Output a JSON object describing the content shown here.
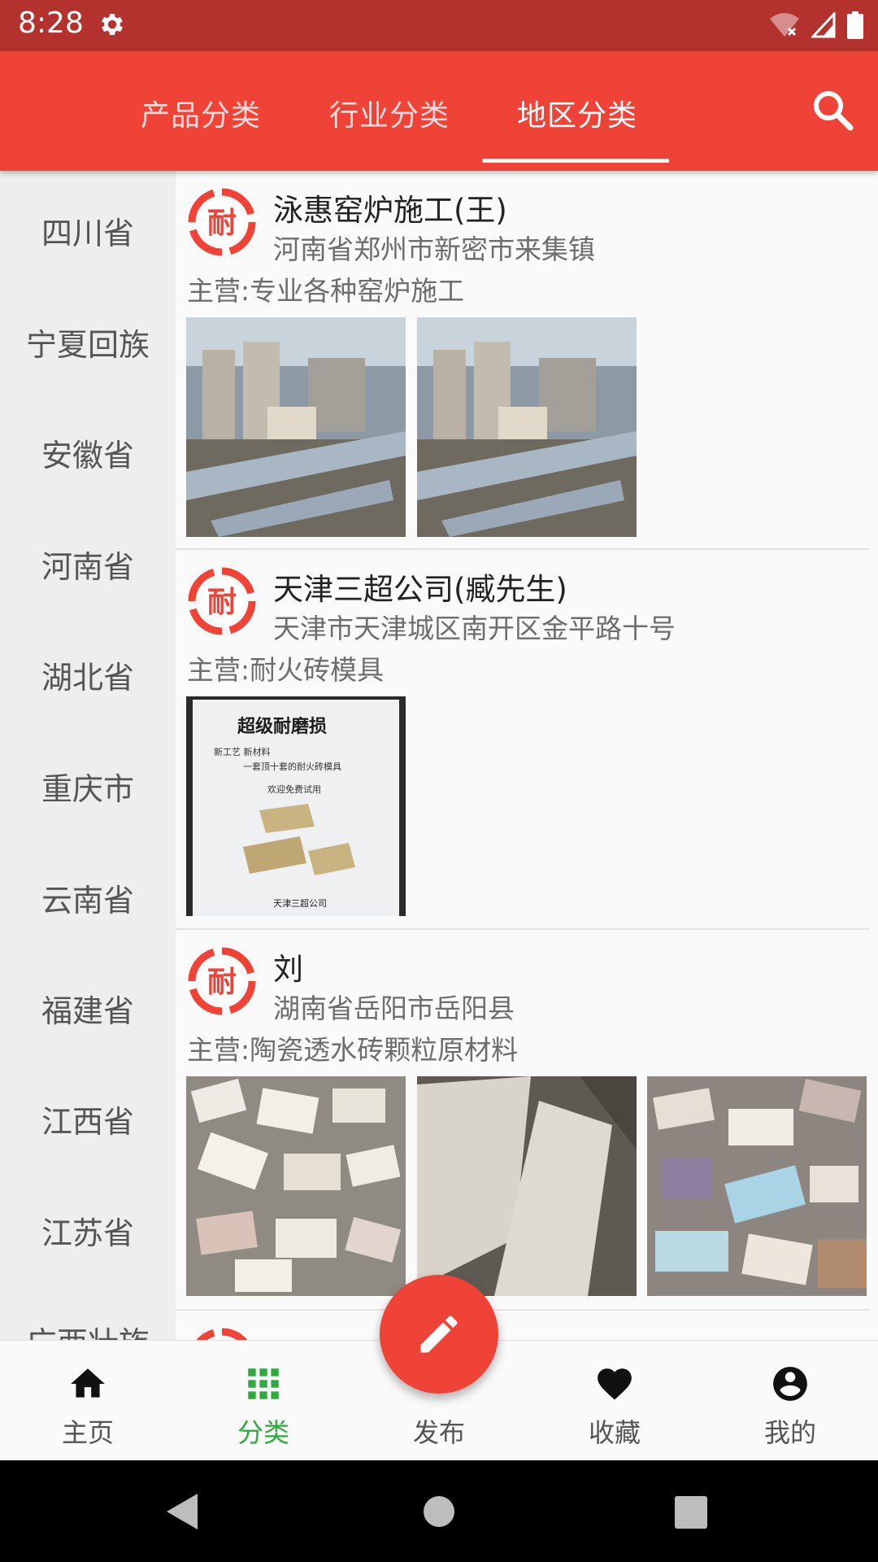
{
  "status_bar": {
    "time": "8:28",
    "icons": [
      "gear-icon",
      "wifi-off-icon",
      "signal-icon",
      "battery-icon"
    ]
  },
  "tabs": [
    {
      "label": "产品分类",
      "active": false
    },
    {
      "label": "行业分类",
      "active": false
    },
    {
      "label": "地区分类",
      "active": true
    }
  ],
  "sidebar": {
    "items": [
      "四川省",
      "宁夏回族",
      "安徽省",
      "河南省",
      "湖北省",
      "重庆市",
      "云南省",
      "福建省",
      "江西省",
      "江苏省",
      "广西壮族"
    ]
  },
  "listings": [
    {
      "logo_char": "耐",
      "name": "泳惠窑炉施工(王)",
      "address": "河南省郑州市新密市来集镇",
      "main": "主营:专业各种窑炉施工",
      "photos": [
        "kiln-construction-photo",
        "kiln-construction-photo"
      ]
    },
    {
      "logo_char": "耐",
      "name": "天津三超公司(臧先生)",
      "address": "天津市天津城区南开区金平路十号",
      "main": "主营:耐火砖模具",
      "photos": [
        "brick-mold-poster-photo"
      ],
      "poster": {
        "title": "超级耐磨损",
        "line1": "新工艺 新材料",
        "line2": "一套顶十套的耐火砖模具",
        "line3": "欢迎免费试用",
        "company": "天津三超公司"
      }
    },
    {
      "logo_char": "耐",
      "name": "刘",
      "address": "湖南省岳阳市岳阳县",
      "main": "主营:陶瓷透水砖颗粒原材料",
      "photos": [
        "ceramic-bricks-photo",
        "stone-slab-photo",
        "ceramic-bricks-photo"
      ]
    }
  ],
  "bottom_nav": [
    {
      "label": "主页",
      "icon": "home-icon",
      "active": false
    },
    {
      "label": "分类",
      "icon": "grid-icon",
      "active": true
    },
    {
      "label": "发布",
      "icon": "pencil-icon",
      "active": false
    },
    {
      "label": "收藏",
      "icon": "heart-icon",
      "active": false
    },
    {
      "label": "我的",
      "icon": "account-icon",
      "active": false
    }
  ],
  "colors": {
    "primary": "#f04338",
    "status_bar": "#b3322d",
    "active_nav": "#2eaa3e"
  }
}
